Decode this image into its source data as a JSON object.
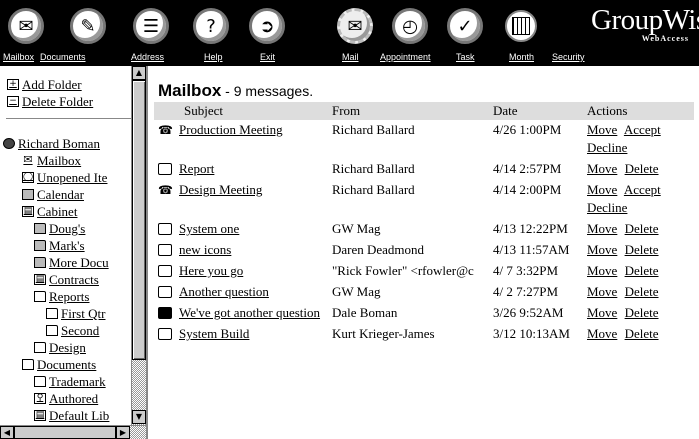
{
  "toolbar": {
    "buttons": [
      {
        "label": "Mailbox",
        "icon": "mailbox-icon"
      },
      {
        "label": "Documents",
        "icon": "documents-icon"
      },
      {
        "label": "Address",
        "icon": "address-book-icon"
      },
      {
        "label": "Help",
        "icon": "help-icon"
      },
      {
        "label": "Exit",
        "icon": "exit-icon"
      },
      {
        "label": "Mail",
        "icon": "mail-icon"
      },
      {
        "label": "Appointment",
        "icon": "appointment-icon"
      },
      {
        "label": "Task",
        "icon": "task-icon"
      },
      {
        "label": "Month",
        "icon": "month-calendar-icon"
      },
      {
        "label": "Security",
        "icon": "security-icon"
      }
    ],
    "brand": {
      "name": "GroupWise",
      "sub": "WebAccess"
    },
    "colors": {
      "background": "#000000",
      "label": "#ffffff"
    }
  },
  "sidebar": {
    "actions": [
      {
        "label": "Add Folder",
        "icon": "plus-box-icon"
      },
      {
        "label": "Delete Folder",
        "icon": "minus-box-icon"
      }
    ],
    "tree": [
      {
        "label": "Richard Boman",
        "icon": "user-globe-icon"
      },
      {
        "label": "Mailbox",
        "icon": "mailbox-icon"
      },
      {
        "label": "Unopened Ite",
        "icon": "unopened-icon"
      },
      {
        "label": "Calendar",
        "icon": "calendar-icon"
      },
      {
        "label": "Cabinet",
        "icon": "cabinet-icon"
      },
      {
        "label": "Doug's",
        "icon": "shared-folder-icon"
      },
      {
        "label": "Mark's",
        "icon": "shared-folder-icon"
      },
      {
        "label": "More Docu",
        "icon": "shared-folder-icon"
      },
      {
        "label": "Contracts",
        "icon": "contracts-folder-icon"
      },
      {
        "label": "Reports",
        "icon": "folder-icon"
      },
      {
        "label": "First Qtr",
        "icon": "folder-icon"
      },
      {
        "label": "Second",
        "icon": "folder-icon"
      },
      {
        "label": "Design",
        "icon": "folder-icon"
      },
      {
        "label": "Documents",
        "icon": "folder-icon"
      },
      {
        "label": "Trademark",
        "icon": "folder-icon"
      },
      {
        "label": "Authored",
        "icon": "authored-icon"
      },
      {
        "label": "Default Lib",
        "icon": "library-icon"
      }
    ]
  },
  "mailbox": {
    "title": "Mailbox",
    "count_text": " - 9 messages.",
    "columns": [
      "Subject",
      "From",
      "Date",
      "Actions"
    ],
    "messages": [
      {
        "icon": "appointment-icon",
        "subject": "Production Meeting",
        "from": "Richard Ballard",
        "date": "4/26 1:00PM",
        "actions": [
          "Move",
          "Accept",
          "Decline"
        ]
      },
      {
        "icon": "envelope-icon",
        "subject": "Report",
        "from": "Richard Ballard",
        "date": "4/14 2:57PM",
        "actions": [
          "Move",
          "Delete"
        ]
      },
      {
        "icon": "appointment-icon",
        "subject": "Design Meeting",
        "from": "Richard Ballard",
        "date": "4/14 2:00PM",
        "actions": [
          "Move",
          "Accept",
          "Decline"
        ]
      },
      {
        "icon": "envelope-open-icon",
        "subject": "System one",
        "from": "GW Mag",
        "date": "4/13 12:22PM",
        "actions": [
          "Move",
          "Delete"
        ]
      },
      {
        "icon": "envelope-open-icon",
        "subject": "new icons",
        "from": "Daren Deadmond",
        "date": "4/13 11:57AM",
        "actions": [
          "Move",
          "Delete"
        ]
      },
      {
        "icon": "envelope-open-icon",
        "subject": "Here you go",
        "from": "\"Rick Fowler\" <rfowler@c",
        "date": "4/ 7 3:32PM",
        "actions": [
          "Move",
          "Delete"
        ]
      },
      {
        "icon": "envelope-open-icon",
        "subject": "Another question",
        "from": "GW Mag",
        "date": "4/ 2 7:27PM",
        "actions": [
          "Move",
          "Delete"
        ]
      },
      {
        "icon": "envelope-unread-icon",
        "subject": "We've got another question",
        "from": "Dale Boman",
        "date": "3/26 9:52AM",
        "actions": [
          "Move",
          "Delete"
        ]
      },
      {
        "icon": "envelope-open-icon",
        "subject": "System Build",
        "from": "Kurt Krieger-James",
        "date": "3/12 10:13AM",
        "actions": [
          "Move",
          "Delete"
        ]
      }
    ]
  }
}
